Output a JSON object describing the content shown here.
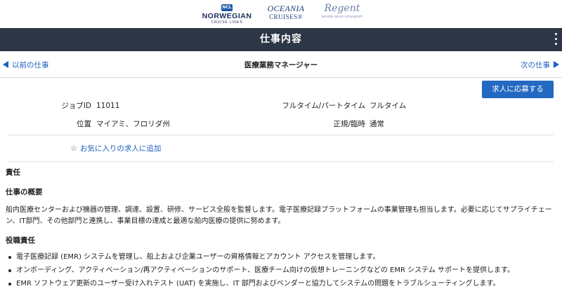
{
  "brands": {
    "ncl_badge": "NCL",
    "ncl_name": "NORWEGIAN",
    "ncl_sub": "CRUISE LINE®",
    "oceania_line1": "OCEANIA",
    "oceania_line2": "CRUISES®",
    "regent_line1": "Regent",
    "regent_line2": "SEVEN SEAS CRUISES®"
  },
  "header": {
    "title": "仕事内容"
  },
  "nav": {
    "prev_label": "以前の仕事",
    "next_label": "次の仕事",
    "job_title": "医療業務マネージャー"
  },
  "apply": {
    "label": "求人に応募する"
  },
  "details": {
    "job_id_label": "ジョブID",
    "job_id_value": "11011",
    "location_label": "位置",
    "location_value": "マイアミ、フロリダ州",
    "time_type_label": "フルタイム/パートタイム",
    "time_type_value": "フルタイム",
    "regular_label": "正規/臨時",
    "regular_value": "通常"
  },
  "favorite": {
    "label": "お気に入りの求人に追加"
  },
  "content": {
    "section_title": "責任",
    "overview_title": "仕事の概要",
    "overview_text": "船内医療センターおよび機器の管理、調達、設置、研修、サービス全般を監督します。電子医療記録プラットフォームの事業管理も担当します。必要に応じてサプライチェーン、IT部門、その他部門と連携し、事業目標の達成と最適な船内医療の提供に努めます。",
    "duties_title": "役職責任",
    "duties": [
      "電子医療記録 (EMR) システムを管理し、船上および企業ユーザーの資格情報とアカウント アクセスを管理します。",
      "オンボーディング、アクティベーション/再アクティベーションのサポート、医療チーム向けの仮想トレーニングなどの EMR システム サポートを提供します。",
      "EMR ソフトウェア更新のユーザー受け入れテスト (UAT) を実施し、IT 部門およびベンダーと協力してシステムの問題をトラブルシューティングします。"
    ]
  }
}
